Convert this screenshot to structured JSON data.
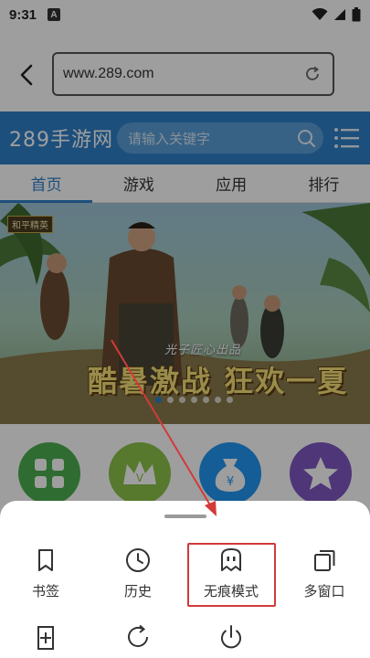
{
  "status_bar": {
    "time": "9:31",
    "notification_letter": "A"
  },
  "address_bar": {
    "url": "www.289.com"
  },
  "site": {
    "logo": "289手游网",
    "search_placeholder": "请输入关键字",
    "tabs": [
      {
        "label": "首页",
        "active": true
      },
      {
        "label": "游戏",
        "active": false
      },
      {
        "label": "应用",
        "active": false
      },
      {
        "label": "排行",
        "active": false
      }
    ]
  },
  "banner": {
    "tag": "和平精英",
    "subtitle": "光子匠心出品",
    "headline": "酷暑激战 狂欢一夏"
  },
  "app_icons": [
    {
      "icon": "grid-apps-icon",
      "color": "#4caf50"
    },
    {
      "icon": "crown-v-icon",
      "color": "#8bc34a"
    },
    {
      "icon": "money-bag-yen-icon",
      "color": "#2196f3"
    },
    {
      "icon": "star-icon",
      "color": "#7e57c2"
    }
  ],
  "menu_sheet": {
    "row1": [
      {
        "label": "书签",
        "icon": "bookmark-icon"
      },
      {
        "label": "历史",
        "icon": "clock-history-icon"
      },
      {
        "label": "无痕模式",
        "icon": "ghost-incognito-icon",
        "highlighted": true
      },
      {
        "label": "多窗口",
        "icon": "multi-window-icon"
      }
    ],
    "row2": [
      {
        "icon": "add-bookmark-icon"
      },
      {
        "icon": "refresh-icon"
      },
      {
        "icon": "power-exit-icon"
      }
    ]
  },
  "colors": {
    "brand_blue": "#2f80c8",
    "highlight_red": "#d33a3a",
    "dim_overlay": "rgba(0,0,0,0.38)"
  }
}
